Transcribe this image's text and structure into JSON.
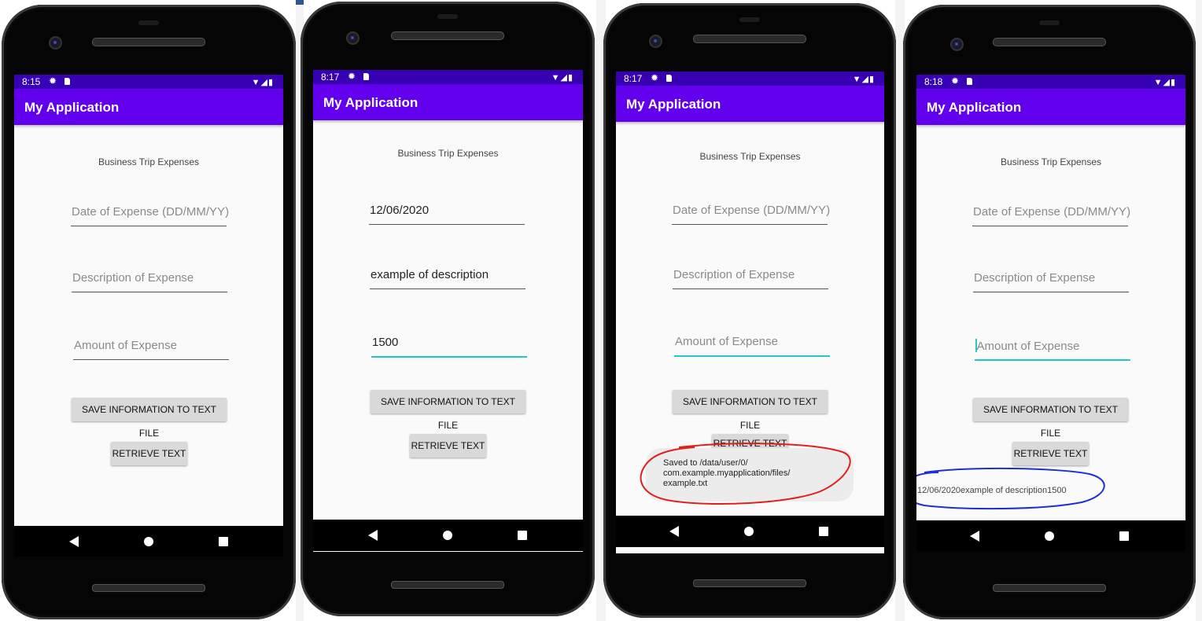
{
  "app": {
    "title": "My Application",
    "heading": "Business Trip Expenses"
  },
  "fields": {
    "date_placeholder": "Date of Expense (DD/MM/YY)",
    "description_placeholder": "Description of Expense",
    "amount_placeholder": "Amount of Expense"
  },
  "buttons": {
    "save": "SAVE INFORMATION TO TEXT FILE",
    "retrieve": "RETRIEVE TEXT"
  },
  "screens": [
    {
      "time": "8:15"
    },
    {
      "time": "8:17",
      "date_value": "12/06/2020",
      "description_value": "example of description",
      "amount_value": "1500"
    },
    {
      "time": "8:17",
      "toast": "Saved to /data/user/0/\ncom.example.myapplication/files/\nexample.txt",
      "retrieve_partial": "RETRIEVE TEXT"
    },
    {
      "time": "8:18",
      "retrieved_text": "12/06/2020example of description1500"
    }
  ],
  "colors": {
    "status_bar": "#3700b3",
    "app_bar": "#6200ee",
    "focus_line": "#26c6c6",
    "annotation_red": "#e0201c",
    "annotation_blue": "#1f2fd0"
  },
  "icons": [
    "gear-icon",
    "sd-card-icon",
    "wifi-signal-icon",
    "battery-icon",
    "back-icon",
    "home-icon",
    "recents-icon"
  ]
}
